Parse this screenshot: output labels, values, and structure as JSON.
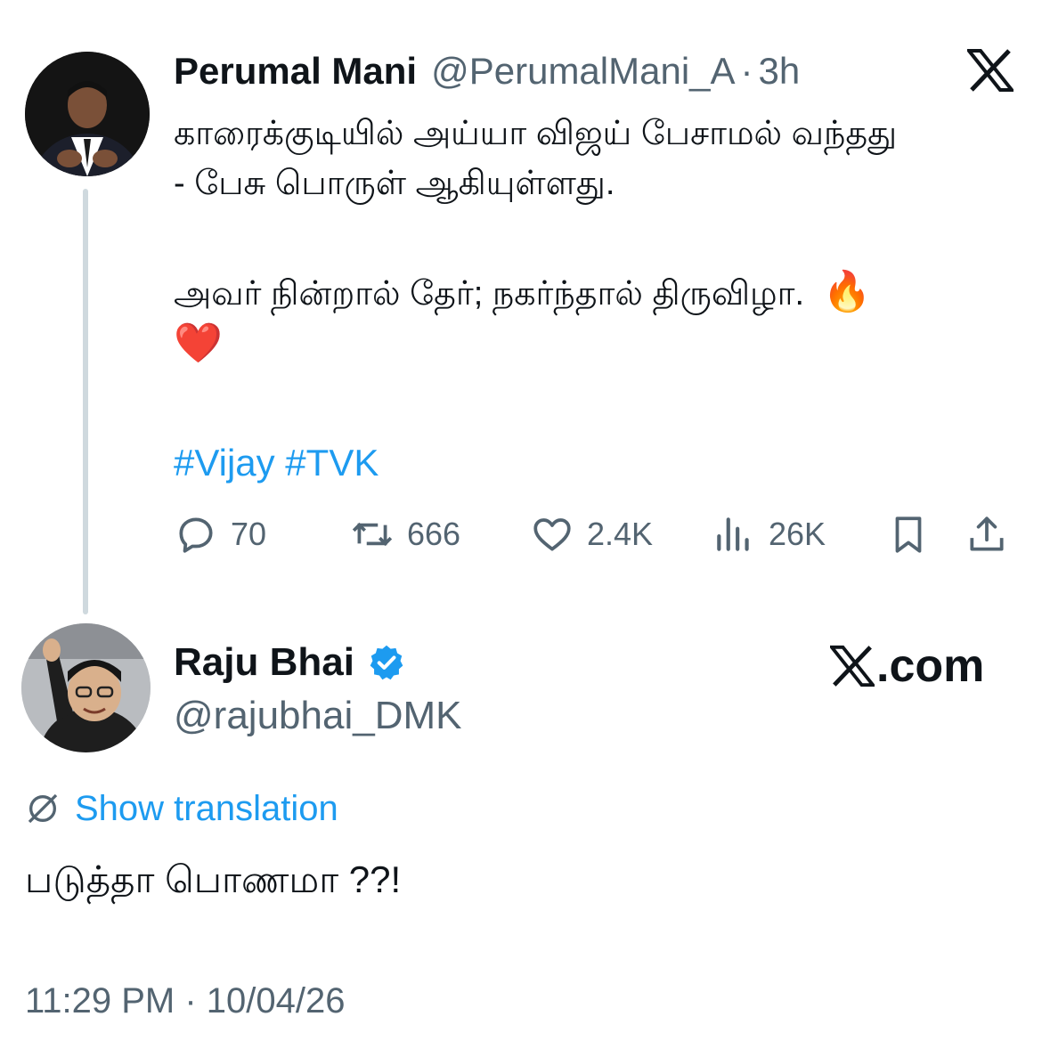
{
  "parent_tweet": {
    "author_name": "Perumal Mani",
    "handle": "@PerumalMani_A",
    "separator": "·",
    "time_ago": "3h",
    "text_lines": [
      "காரைக்குடியில் அய்யா விஜய் பேசாமல் வந்தது",
      "- பேசு பொருள் ஆகியுள்ளது.",
      "அவர் நின்றால் தேர்; நகர்ந்தால் திருவிழா."
    ],
    "emojis": [
      "🔥",
      "❤️"
    ],
    "hashtags": "#Vijay #TVK",
    "stats": {
      "replies": "70",
      "reposts": "666",
      "likes": "2.4K",
      "views": "26K"
    }
  },
  "reply_tweet": {
    "author_name": "Raju Bhai",
    "handle": "@rajubhai_DMK",
    "verified": true,
    "brand": ".com",
    "show_translation": "Show translation",
    "text": "படுத்தா பொணமா ??!",
    "timestamp": "11:29 PM · 10/04/26"
  },
  "colors": {
    "text": "#0f1419",
    "secondary": "#536471",
    "link": "#1d9bf0",
    "thread_line": "#cfd9de"
  }
}
